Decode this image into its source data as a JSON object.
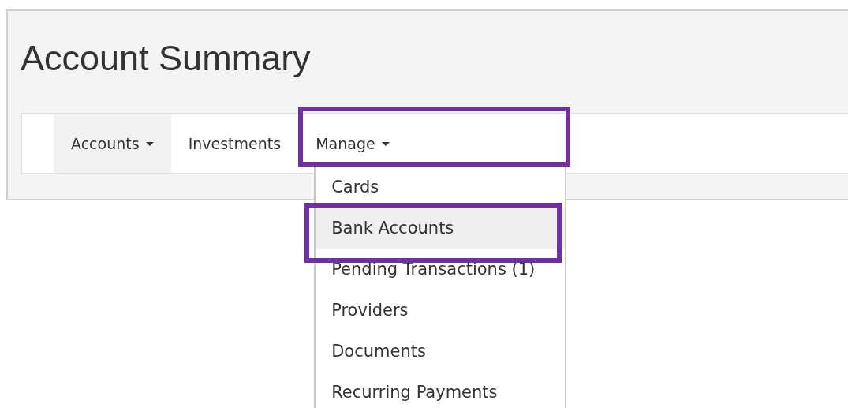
{
  "page_title": "Account Summary",
  "tabs": [
    {
      "label": "Accounts",
      "kind": "dropdown",
      "selected": true,
      "expanded": false,
      "highlighted": false
    },
    {
      "label": "Investments",
      "kind": "link",
      "selected": false,
      "highlighted": false
    },
    {
      "label": "Manage",
      "kind": "dropdown",
      "selected": false,
      "expanded": true,
      "highlighted": true,
      "menu": [
        {
          "label": "Cards",
          "hovered": false,
          "highlighted": false
        },
        {
          "label": "Bank Accounts",
          "hovered": true,
          "highlighted": true
        },
        {
          "label": "Pending Transactions (1)",
          "hovered": false,
          "highlighted": false
        },
        {
          "label": "Providers",
          "hovered": false,
          "highlighted": false
        },
        {
          "label": "Documents",
          "hovered": false,
          "highlighted": false
        },
        {
          "label": "Recurring Payments",
          "hovered": false,
          "highlighted": false
        }
      ]
    }
  ]
}
